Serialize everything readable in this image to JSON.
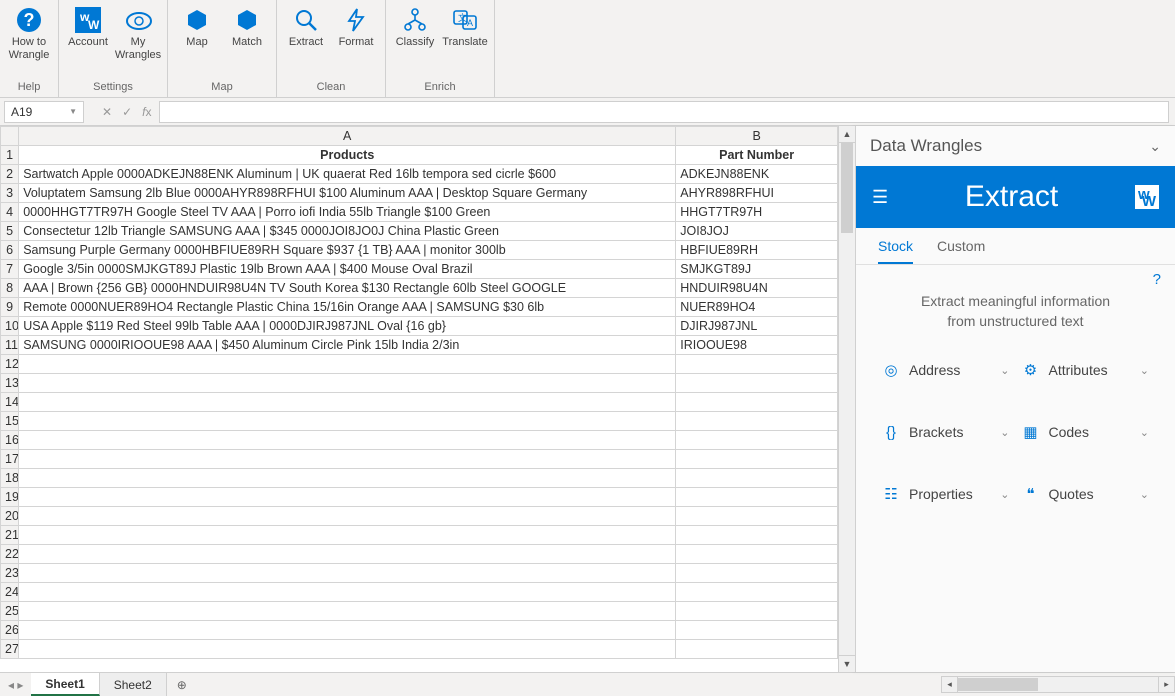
{
  "ribbon": {
    "groups": [
      {
        "label": "Help",
        "items": [
          {
            "label": "How to\nWrangle",
            "icon": "help-circle"
          }
        ]
      },
      {
        "label": "Settings",
        "items": [
          {
            "label": "Account",
            "icon": "ww-logo"
          },
          {
            "label": "My\nWrangles",
            "icon": "cloud-gear"
          }
        ]
      },
      {
        "label": "Map",
        "items": [
          {
            "label": "Map",
            "icon": "hex"
          },
          {
            "label": "Match",
            "icon": "hex"
          }
        ]
      },
      {
        "label": "Clean",
        "items": [
          {
            "label": "Extract",
            "icon": "magnifier"
          },
          {
            "label": "Format",
            "icon": "bolt"
          }
        ]
      },
      {
        "label": "Enrich",
        "items": [
          {
            "label": "Classify",
            "icon": "tree"
          },
          {
            "label": "Translate",
            "icon": "translate"
          }
        ]
      }
    ]
  },
  "namebox": "A19",
  "columns": [
    "A",
    "B"
  ],
  "headers": {
    "A": "Products",
    "B": "Part Number"
  },
  "rows": [
    {
      "A": "Sartwatch Apple     0000ADKEJN88ENK Aluminum | UK quaerat Red 16lb tempora sed cicrle $600",
      "B": "ADKEJN88ENK"
    },
    {
      "A": "Voluptatem Samsung      2lb Blue 0000AHYR898RFHUI $100 Aluminum AAA | Desktop Square Germany",
      "B": "AHYR898RFHUI"
    },
    {
      "A": "0000HHGT7TR97H Google     Steel TV AAA | Porro iofi India 55lb Triangle $100 Green",
      "B": "HHGT7TR97H"
    },
    {
      "A": "Consectetur 12lb Triangle  SAMSUNG      AAA | $345 0000JOI8JO0J China Plastic Green",
      "B": "JOI8JOJ"
    },
    {
      "A": "Samsung     Purple Germany 0000HBFIUE89RH Square $937 {1 TB} AAA | monitor 300lb",
      "B": "HBFIUE89RH"
    },
    {
      "A": "Google     3/5in 0000SMJKGT89J Plastic 19lb Brown AAA | $400 Mouse Oval Brazil",
      "B": "SMJKGT89J"
    },
    {
      "A": "AAA | Brown {256 GB} 0000HNDUIR98U4N TV South Korea $130 Rectangle 60lb Steel GOOGLE",
      "B": "HNDUIR98U4N"
    },
    {
      "A": "Remote 0000NUER89HO4 Rectangle Plastic China 15/16in   Orange AAA | SAMSUNG     $30 6lb",
      "B": "NUER89HO4"
    },
    {
      "A": "USA Apple     $119 Red Steel 99lb Table AAA | 0000DJIRJ987JNL Oval {16 gb}",
      "B": "DJIRJ987JNL"
    },
    {
      "A": "SAMSUNG      0000IRIOOUE98 AAA | $450 Aluminum Circle Pink 15lb India 2/3in",
      "B": "IRIOOUE98"
    }
  ],
  "blank_rows": 16,
  "sheets": {
    "active": "Sheet1",
    "other": "Sheet2"
  },
  "sidepanel": {
    "title": "Data Wrangles",
    "hero": "Extract",
    "tabs": {
      "active": "Stock",
      "other": "Custom"
    },
    "desc1": "Extract meaningful information",
    "desc2": "from unstructured text",
    "help": "?",
    "items": [
      {
        "label": "Address",
        "icon": "◎"
      },
      {
        "label": "Attributes",
        "icon": "⚙"
      },
      {
        "label": "Brackets",
        "icon": "{}"
      },
      {
        "label": "Codes",
        "icon": "▦"
      },
      {
        "label": "Properties",
        "icon": "☷"
      },
      {
        "label": "Quotes",
        "icon": "❝"
      }
    ]
  }
}
